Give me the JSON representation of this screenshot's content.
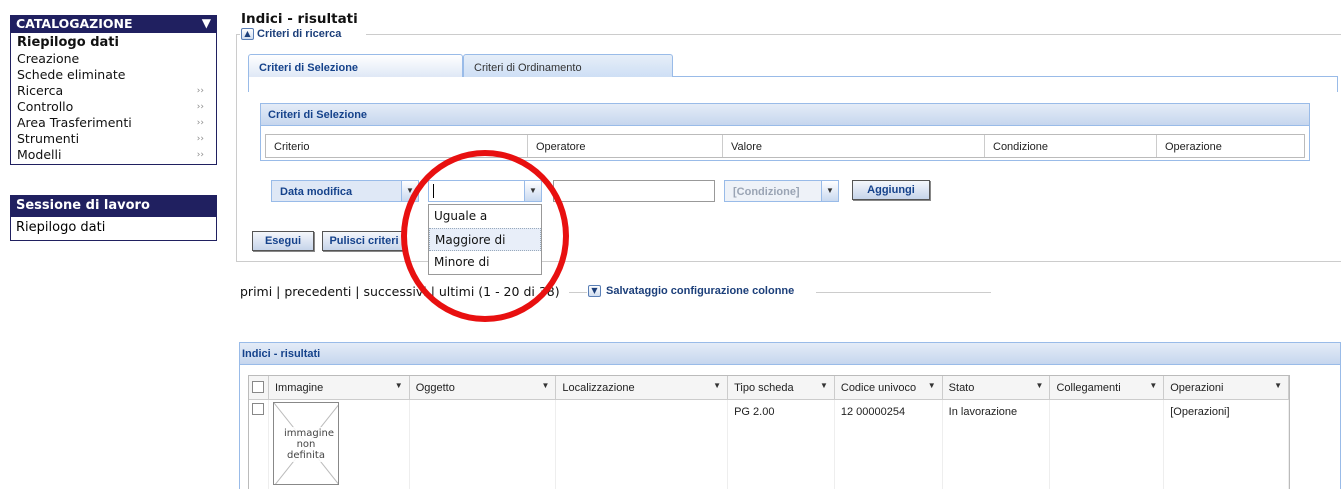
{
  "sidebar": {
    "header": "CATALOGAZIONE",
    "items": [
      {
        "label": "Riepilogo dati"
      },
      {
        "label": "Creazione"
      },
      {
        "label": "Schede eliminate"
      },
      {
        "label": "Ricerca"
      },
      {
        "label": "Controllo"
      },
      {
        "label": "Area Trasferimenti"
      },
      {
        "label": "Strumenti"
      },
      {
        "label": "Modelli"
      }
    ],
    "session_header": "Sessione di lavoro",
    "session_item": "Riepilogo dati"
  },
  "main": {
    "title": "Indici - risultati",
    "criteria_legend": "Criteri di ricerca",
    "tabs": [
      {
        "label": "Criteri di Selezione"
      },
      {
        "label": "Criteri di Ordinamento"
      }
    ],
    "selection_panel": {
      "title": "Criteri di Selezione",
      "columns": [
        "Criterio",
        "Operatore",
        "Valore",
        "Condizione",
        "Operazione"
      ]
    },
    "criterio_combo": "Data modifica",
    "operator_value": "",
    "value_input": "",
    "condition_combo": "[Condizione]",
    "add_button": "Aggiungi",
    "execute_button": "Esegui",
    "clear_button": "Pulisci criteri",
    "operator_options": [
      {
        "label": "Uguale a"
      },
      {
        "label": "Maggiore di"
      },
      {
        "label": "Minore di"
      }
    ],
    "pager": "primi | precedenti | successivi | ultimi (1 - 20 di 38)",
    "save_columns": "Salvataggio configurazione colonne",
    "results": {
      "title": "Indici - risultati",
      "columns": [
        "Immagine",
        "Oggetto",
        "Localizzazione",
        "Tipo scheda",
        "Codice univoco",
        "Stato",
        "Collegamenti",
        "Operazioni"
      ],
      "rows": [
        {
          "image_text": "immagine non definita",
          "oggetto": "",
          "localizzazione": "",
          "tipo_scheda": "PG 2.00",
          "codice_univoco": "12 00000254",
          "stato": "In lavorazione",
          "collegamenti": "",
          "operazioni": "[Operazioni]"
        }
      ]
    }
  },
  "annotation": {
    "color": "#e81010"
  }
}
